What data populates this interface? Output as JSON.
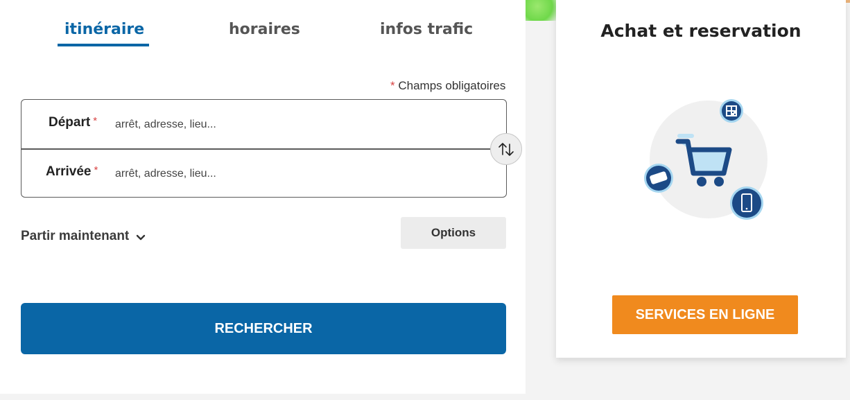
{
  "tabs": [
    {
      "label": "itinéraire",
      "active": true
    },
    {
      "label": "horaires",
      "active": false
    },
    {
      "label": "infos trafic",
      "active": false
    }
  ],
  "form": {
    "required_star": "*",
    "required_note": "Champs obligatoires",
    "departure": {
      "label": "Départ",
      "placeholder": "arrêt, adresse, lieu..."
    },
    "arrival": {
      "label": "Arrivée",
      "placeholder": "arrêt, adresse, lieu..."
    },
    "departure_time": "Partir maintenant",
    "options_label": "Options",
    "search_label": "RECHERCHER"
  },
  "purchase_card": {
    "title": "Achat et reservation",
    "button_label": "SERVICES EN LIGNE"
  },
  "colors": {
    "primary_blue": "#0a66a6",
    "orange": "#f08a1e",
    "required_red": "#d84343"
  }
}
